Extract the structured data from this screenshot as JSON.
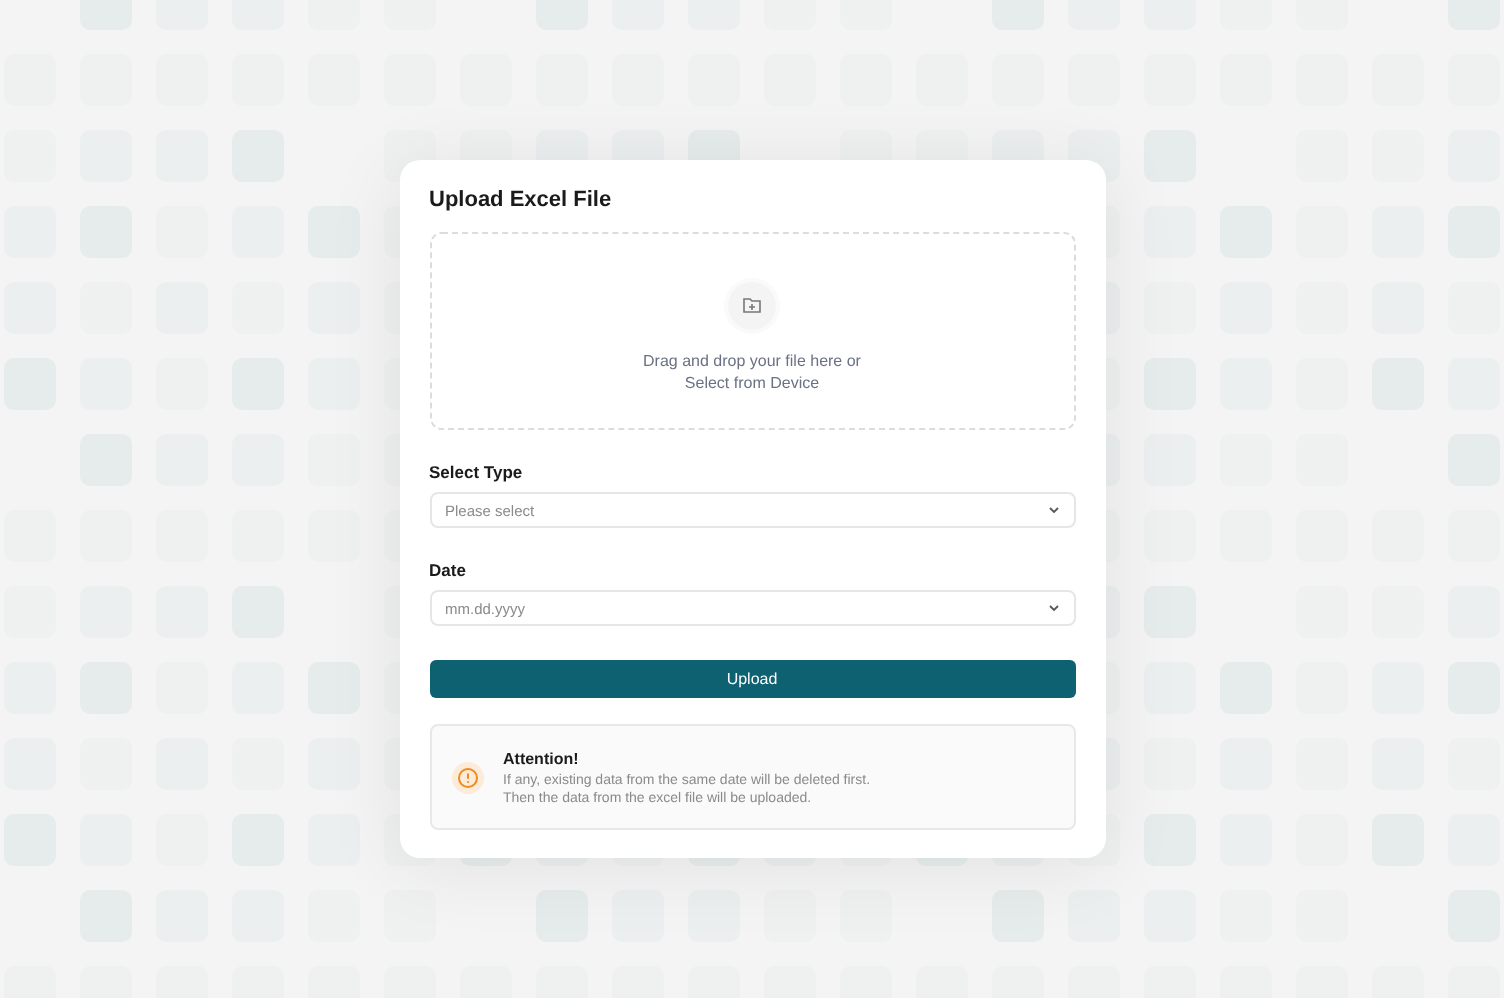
{
  "dialog": {
    "title": "Upload Excel File"
  },
  "dropzone": {
    "prompt": "Drag and drop your file here or",
    "link": "Select from Device"
  },
  "fields": [
    {
      "label": "Select Type",
      "placeholder": "Please select"
    },
    {
      "label": "Date",
      "placeholder": "mm.dd.yyyy"
    }
  ],
  "upload_button": "Upload",
  "notice": {
    "title": "Attention!",
    "lines": [
      "If any, existing data from the same date will be deleted first.",
      "Then the data from the excel file will be uploaded."
    ]
  }
}
